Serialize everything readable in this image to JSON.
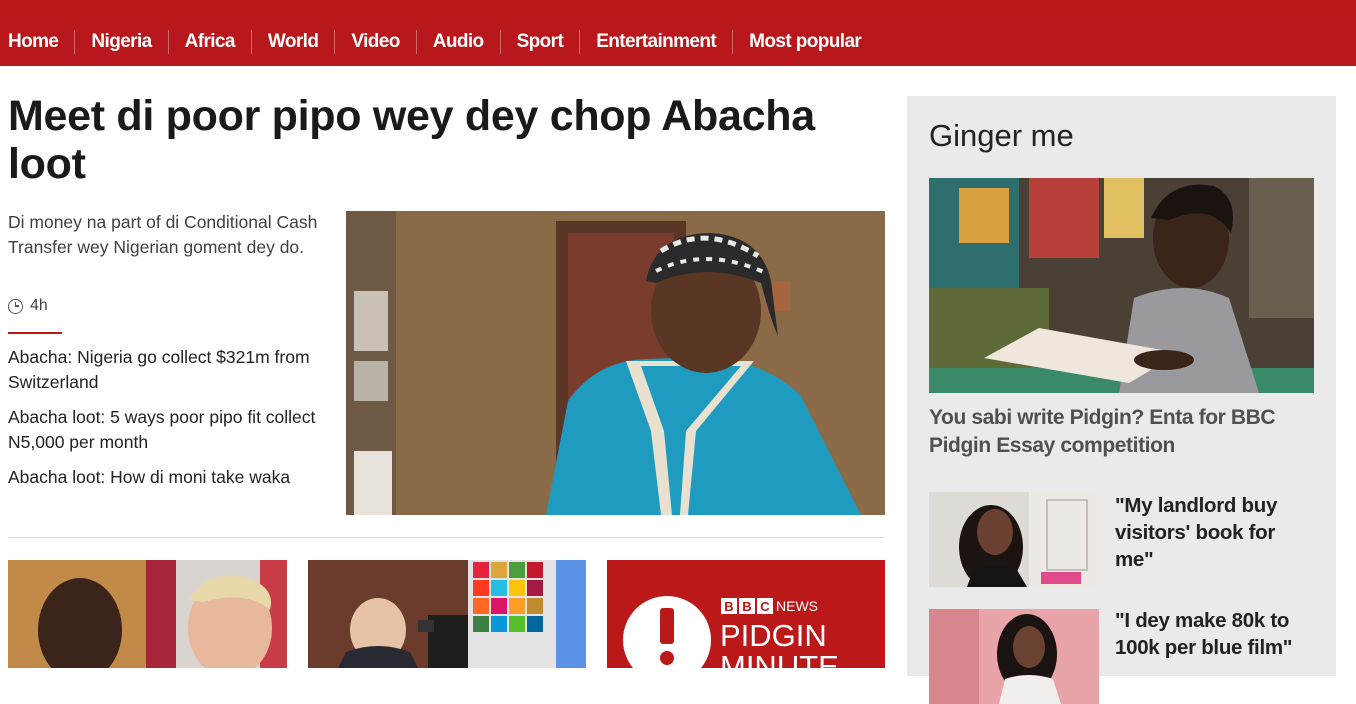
{
  "nav": {
    "items": [
      "Home",
      "Nigeria",
      "Africa",
      "World",
      "Video",
      "Audio",
      "Sport",
      "Entertainment",
      "Most popular"
    ]
  },
  "article": {
    "headline": "Meet di poor pipo wey dey chop Abacha loot",
    "summary": "Di money na part of di Conditional Cash Transfer wey Nigerian goment dey do.",
    "time": "4h",
    "related": [
      "Abacha: Nigeria go collect $321m from Switzerland",
      "Abacha loot: 5 ways poor pipo fit collect N5,000 per month",
      "Abacha loot: How di moni take waka"
    ]
  },
  "promo": {
    "bbc_letters": [
      "B",
      "B",
      "C"
    ],
    "news_label": "NEWS",
    "line1": "PIDGIN",
    "line2": "MINUTE"
  },
  "sidebar": {
    "title": "Ginger me",
    "feature_headline": "You sabi write Pidgin? Enta for BBC Pidgin Essay competition",
    "stories": [
      "\"My landlord buy visitors' book for me\"",
      "\"I dey make 80k to 100k per blue film\""
    ]
  },
  "colors": {
    "brand_red": "#bb1919",
    "nav_red": "#b8171b",
    "sidebar_bg": "#eaeaea"
  }
}
